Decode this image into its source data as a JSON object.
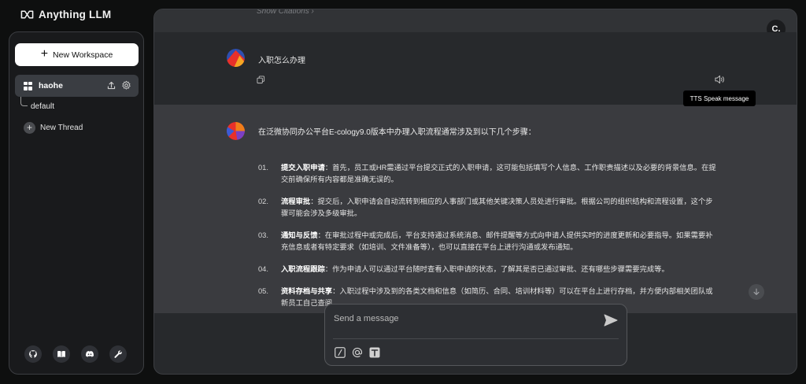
{
  "app": {
    "title": "Anything LLM"
  },
  "sidebar": {
    "new_workspace_label": "New Workspace",
    "workspace": {
      "name": "haohe"
    },
    "threads": [
      {
        "label": "default"
      }
    ],
    "new_thread_label": "New Thread",
    "footer_icons": [
      "github-icon",
      "docs-book-icon",
      "discord-icon",
      "wrench-icon"
    ]
  },
  "chat": {
    "show_citations": "Show Citations",
    "user_avatar_initial": "C.",
    "user_message": "入职怎么办理",
    "tooltip": "TTS Speak message",
    "assistant_intro": "在泛微协同办公平台E-cology9.0版本中办理入职流程通常涉及到以下几个步骤：",
    "steps": [
      {
        "num": "01.",
        "title": "提交入职申请",
        "text": "：首先，员工或HR需通过平台提交正式的入职申请，这可能包括填写个人信息、工作职责描述以及必要的背景信息。在提交前确保所有内容都是准确无误的。"
      },
      {
        "num": "02.",
        "title": "流程审批",
        "text": "：提交后，入职申请会自动流转到相应的人事部门或其他关键决策人员处进行审批。根据公司的组织结构和流程设置，这个步骤可能会涉及多级审批。"
      },
      {
        "num": "03.",
        "title": "通知与反馈",
        "text": "：在审批过程中或完成后，平台支持通过系统消息、邮件提醒等方式向申请人提供实时的进度更新和必要指导。如果需要补充信息或者有特定要求（如培训、文件准备等），也可以直接在平台上进行沟通或发布通知。"
      },
      {
        "num": "04.",
        "title": "入职流程跟踪",
        "text": "：作为申请人可以通过平台随时查看入职申请的状态，了解其是否已通过审批、还有哪些步骤需要完成等。"
      },
      {
        "num": "05.",
        "title": "资料存档与共享",
        "text": "：入职过程中涉及到的各类文档和信息（如简历、合同、培训材料等）可以在平台上进行存档，并方便内部相关团队或新员工自己查阅。"
      }
    ]
  },
  "composer": {
    "placeholder": "Send a message"
  },
  "colors": {
    "background": "#0e0f0f",
    "panel": "#27292c",
    "assistant_bg": "#3a3b3f",
    "sidebar": "#191a1c",
    "active_workspace": "#3a3d42"
  }
}
